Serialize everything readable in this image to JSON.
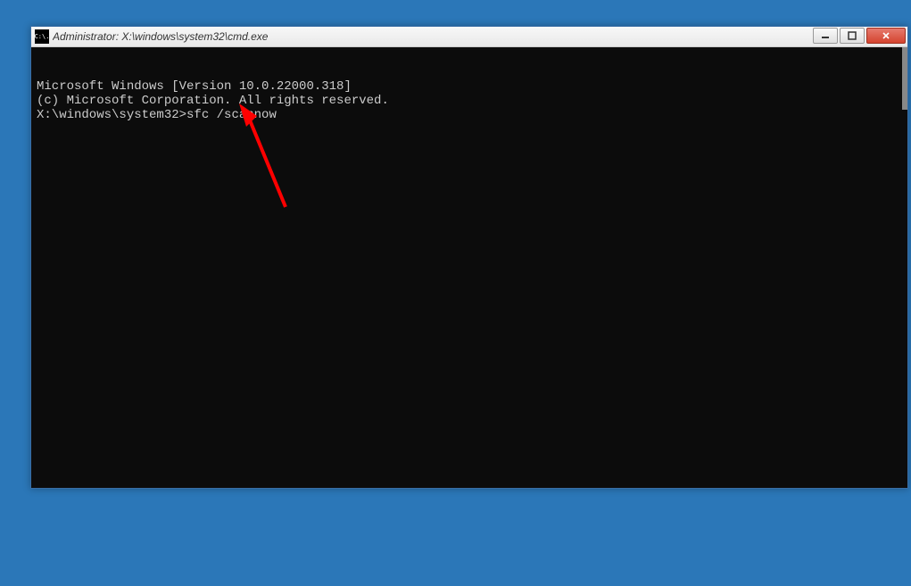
{
  "window": {
    "title": "Administrator: X:\\windows\\system32\\cmd.exe",
    "icon_label": "C:\\."
  },
  "terminal": {
    "line1": "Microsoft Windows [Version 10.0.22000.318]",
    "line2": "(c) Microsoft Corporation. All rights reserved.",
    "blank": "",
    "prompt": "X:\\windows\\system32>",
    "command": "sfc /scannow"
  },
  "colors": {
    "desktop_bg": "#2b77b8",
    "terminal_bg": "#0c0c0c",
    "terminal_fg": "#cccccc",
    "close_btn": "#d4442f",
    "annotation_red": "#ff0000"
  }
}
